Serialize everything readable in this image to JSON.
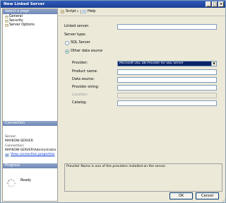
{
  "window": {
    "title": "New Linked Server"
  },
  "left": {
    "select_page_header": "Select a page",
    "pages": [
      {
        "label": "General",
        "icon": "page-icon"
      },
      {
        "label": "Security",
        "icon": "page-icon"
      },
      {
        "label": "Server Options",
        "icon": "page-icon"
      }
    ],
    "connection_header": "Connection",
    "server_label": "Server:",
    "server_value": "MAYKOW-SERVER",
    "connection_label": "Connection:",
    "connection_value": "MAYKOW-SERVER\\Administrator",
    "view_props_link": "View connection properties",
    "progress_header": "Progress",
    "progress_status": "Ready"
  },
  "toolbar": {
    "script_label": "Script",
    "help_label": "Help"
  },
  "form": {
    "linked_server_label": "Linked server:",
    "linked_server_value": "",
    "server_type_label": "Server type:",
    "sql_server_label": "SQL Server",
    "other_source_label": "Other data source",
    "provider_label": "Provider:",
    "provider_value": "Microsoft OLE DB Provider for SQL Server",
    "product_name_label": "Product name:",
    "data_source_label": "Data source:",
    "provider_string_label": "Provider string:",
    "location_label": "Location:",
    "catalog_label": "Catalog:",
    "description": "Provider Name is one of the providers installed on the server."
  },
  "buttons": {
    "ok": "OK",
    "cancel": "Cancel"
  },
  "colors": {
    "title_bar": "#2f5bb8",
    "section_header": "#7f96c0",
    "selected_provider": "#0a246a"
  }
}
